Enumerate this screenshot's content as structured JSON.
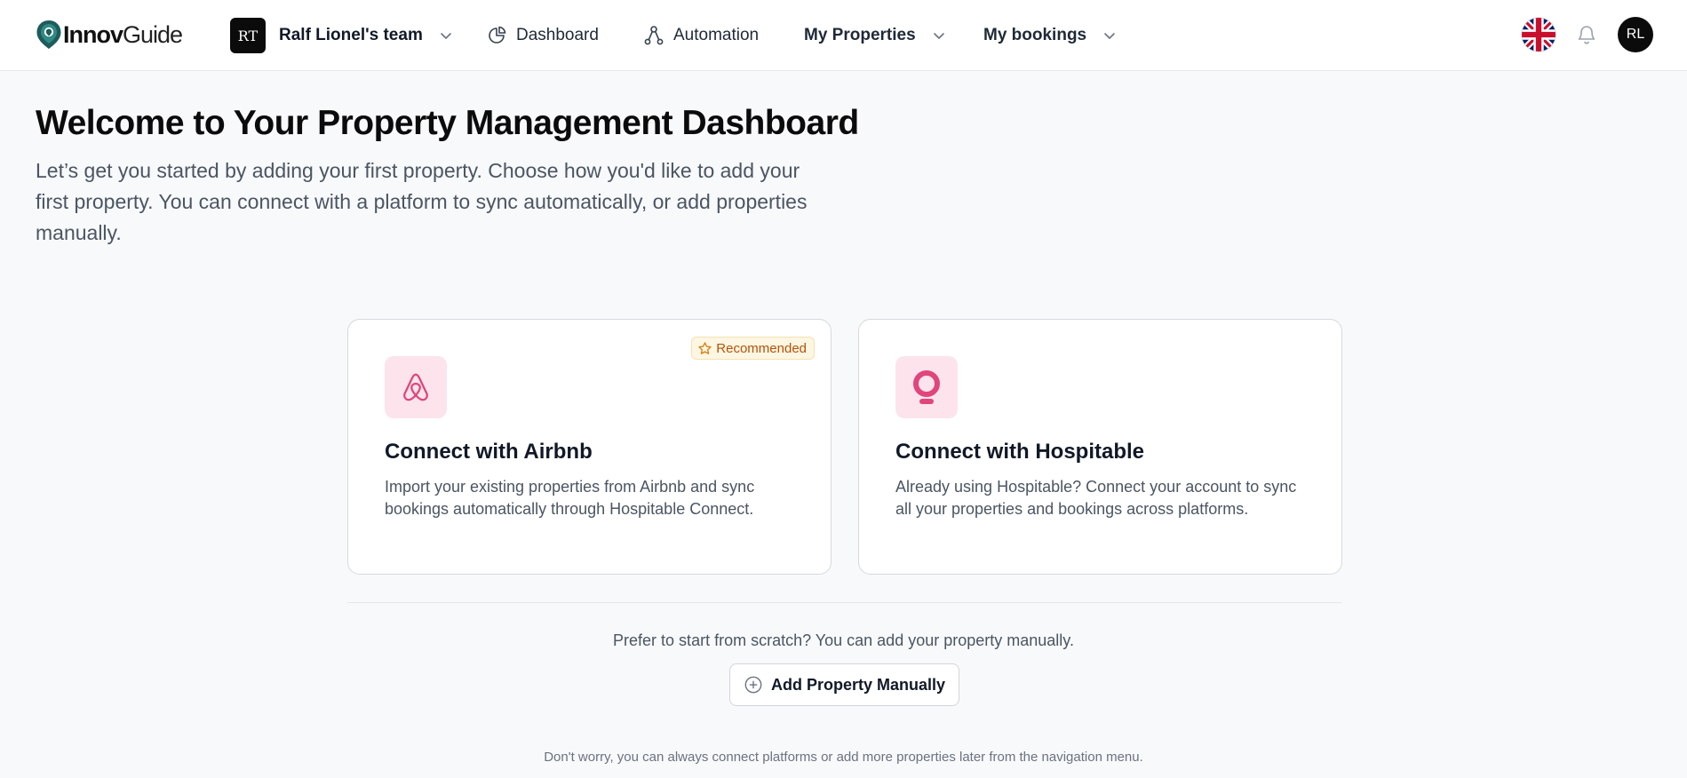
{
  "brand": {
    "name_bold": "Innov",
    "name_light": "Guide"
  },
  "header": {
    "team": {
      "initials": "RT",
      "name": "Ralf Lionel's team"
    },
    "nav": {
      "dashboard": "Dashboard",
      "automation": "Automation",
      "properties": "My Properties",
      "bookings": "My bookings"
    },
    "language_icon": "uk-flag-icon",
    "notifications_icon": "bell-icon",
    "user_initials": "RL"
  },
  "hero": {
    "title": "Welcome to Your Property Management Dashboard",
    "subtitle": "Let’s get you started by adding your first property. Choose how you'd like to add your first property. You can connect with a platform to sync automatically, or add properties manually."
  },
  "cards": [
    {
      "icon": "airbnb-icon",
      "badge": "Recommended",
      "title": "Connect with Airbnb",
      "description": "Import your existing properties from Airbnb and sync bookings automatically through Hospitable Connect."
    },
    {
      "icon": "hospitable-icon",
      "title": "Connect with Hospitable",
      "description": "Already using Hospitable? Connect your account to sync all your properties and bookings across platforms."
    }
  ],
  "manual": {
    "prompt": "Prefer to start from scratch? You can add your property manually.",
    "button_label": "Add Property Manually"
  },
  "footnote": "Don't worry, you can always connect platforms or add more properties later from the navigation menu.",
  "colors": {
    "accent_pink": "#e0457b",
    "pink_bg": "#fde4ec",
    "badge_text": "#b45309",
    "dark": "#0b0b0b"
  }
}
